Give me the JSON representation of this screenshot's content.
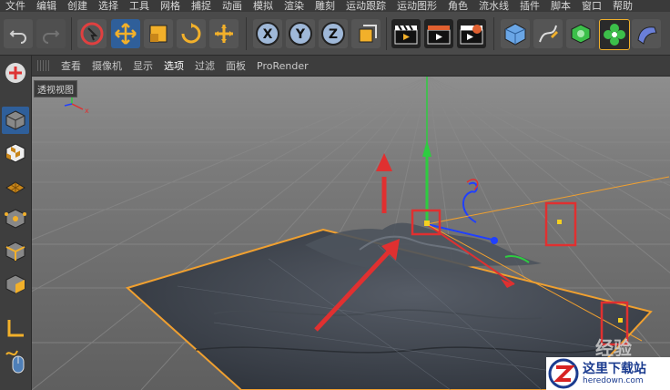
{
  "menubar": {
    "items": [
      "文件",
      "编辑",
      "创建",
      "选择",
      "工具",
      "网格",
      "捕捉",
      "动画",
      "模拟",
      "渲染",
      "雕刻",
      "运动跟踪",
      "运动图形",
      "角色",
      "流水线",
      "插件",
      "脚本",
      "窗口",
      "帮助"
    ]
  },
  "toolbar": {
    "axis_x": "X",
    "axis_y": "Y",
    "axis_z": "Z"
  },
  "viewmenu": {
    "items": [
      "查看",
      "摄像机",
      "显示",
      "选项",
      "过滤",
      "面板",
      "ProRender"
    ],
    "active_index": 3
  },
  "viewport": {
    "label": "透视视图",
    "overlay_text": "经验"
  },
  "watermark": {
    "title": "这里下载站",
    "subtitle": "heredown.com"
  },
  "colors": {
    "highlight_red": "#e03030",
    "orange_edge": "#f0a030",
    "axis_green": "#2ecc40",
    "axis_blue": "#2040ff",
    "terrain": "#3a3f48"
  }
}
